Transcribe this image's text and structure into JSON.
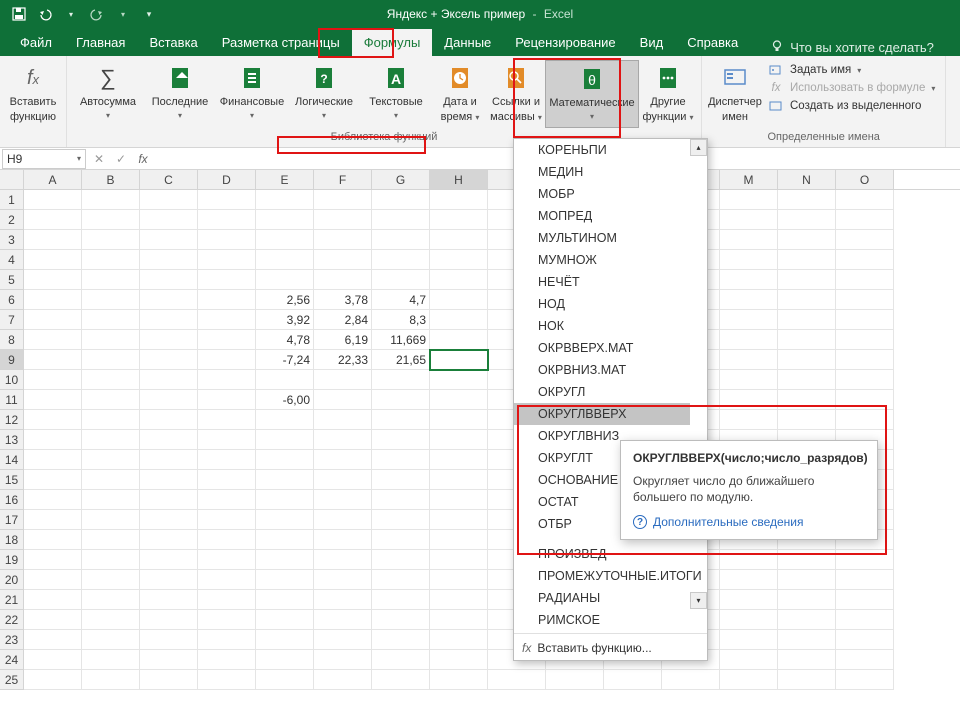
{
  "title": {
    "doc": "Яндекс + Эксель пример",
    "app": "Excel",
    "sep": "-"
  },
  "tabs": {
    "file": "Файл",
    "items": [
      "Главная",
      "Вставка",
      "Разметка страницы",
      "Формулы",
      "Данные",
      "Рецензирование",
      "Вид",
      "Справка"
    ],
    "active_index": 3,
    "tell_me": "Что вы хотите сделать?"
  },
  "ribbon": {
    "insert_fn": {
      "l1": "Вставить",
      "l2": "функцию"
    },
    "lib": {
      "autosum": "Автосумма",
      "recent": "Последние",
      "financial": "Финансовые",
      "logical": "Логические",
      "text": "Текстовые",
      "datetime_l1": "Дата и",
      "datetime_l2": "время",
      "lookup_l1": "Ссылки и",
      "lookup_l2": "массивы",
      "math": "Математические",
      "more_l1": "Другие",
      "more_l2": "функции",
      "group_label": "Библиотека функций"
    },
    "names": {
      "mgr_l1": "Диспетчер",
      "mgr_l2": "имен",
      "define": "Задать имя",
      "use": "Использовать в формуле",
      "create": "Создать из выделенного",
      "group_label": "Определенные имена"
    }
  },
  "formula_bar": {
    "name_box": "H9",
    "fx": "fx"
  },
  "grid": {
    "cols": [
      "A",
      "B",
      "C",
      "D",
      "E",
      "F",
      "G",
      "H",
      "I",
      "J",
      "K",
      "L",
      "M",
      "N",
      "O"
    ],
    "sel_col_index": 7,
    "rows": 25,
    "sel_row": 9,
    "cells": {
      "E6": "2,56",
      "F6": "3,78",
      "G6": "4,7",
      "E7": "3,92",
      "F7": "2,84",
      "G7": "8,3",
      "E8": "4,78",
      "F8": "6,19",
      "G8": "11,669",
      "E9": "-7,24",
      "F9": "22,33",
      "G9": "21,65",
      "E11": "-6,00"
    }
  },
  "dropdown": {
    "items": [
      "КОРЕНЬПИ",
      "МЕДИН",
      "МОБР",
      "МОПРЕД",
      "МУЛЬТИНОМ",
      "МУМНОЖ",
      "НЕЧЁТ",
      "НОД",
      "НОК",
      "ОКРВВЕРХ.МАТ",
      "ОКРВНИЗ.МАТ",
      "ОКРУГЛ",
      "ОКРУГЛВВЕРХ",
      "ОКРУГЛВНИЗ",
      "ОКРУГЛТ",
      "ОСНОВАНИЕ",
      "ОСТАТ",
      "ОТБР",
      "",
      "ПРОИЗВЕД",
      "ПРОМЕЖУТОЧНЫЕ.ИТОГИ",
      "РАДИАНЫ",
      "РИМСКОЕ"
    ],
    "hover_index": 12,
    "footer": "Вставить функцию...",
    "fx": "fx"
  },
  "tooltip": {
    "signature": "ОКРУГЛВВЕРХ(число;число_разрядов)",
    "desc": "Округляет число до ближайшего большего по модулю.",
    "link": "Дополнительные сведения"
  }
}
